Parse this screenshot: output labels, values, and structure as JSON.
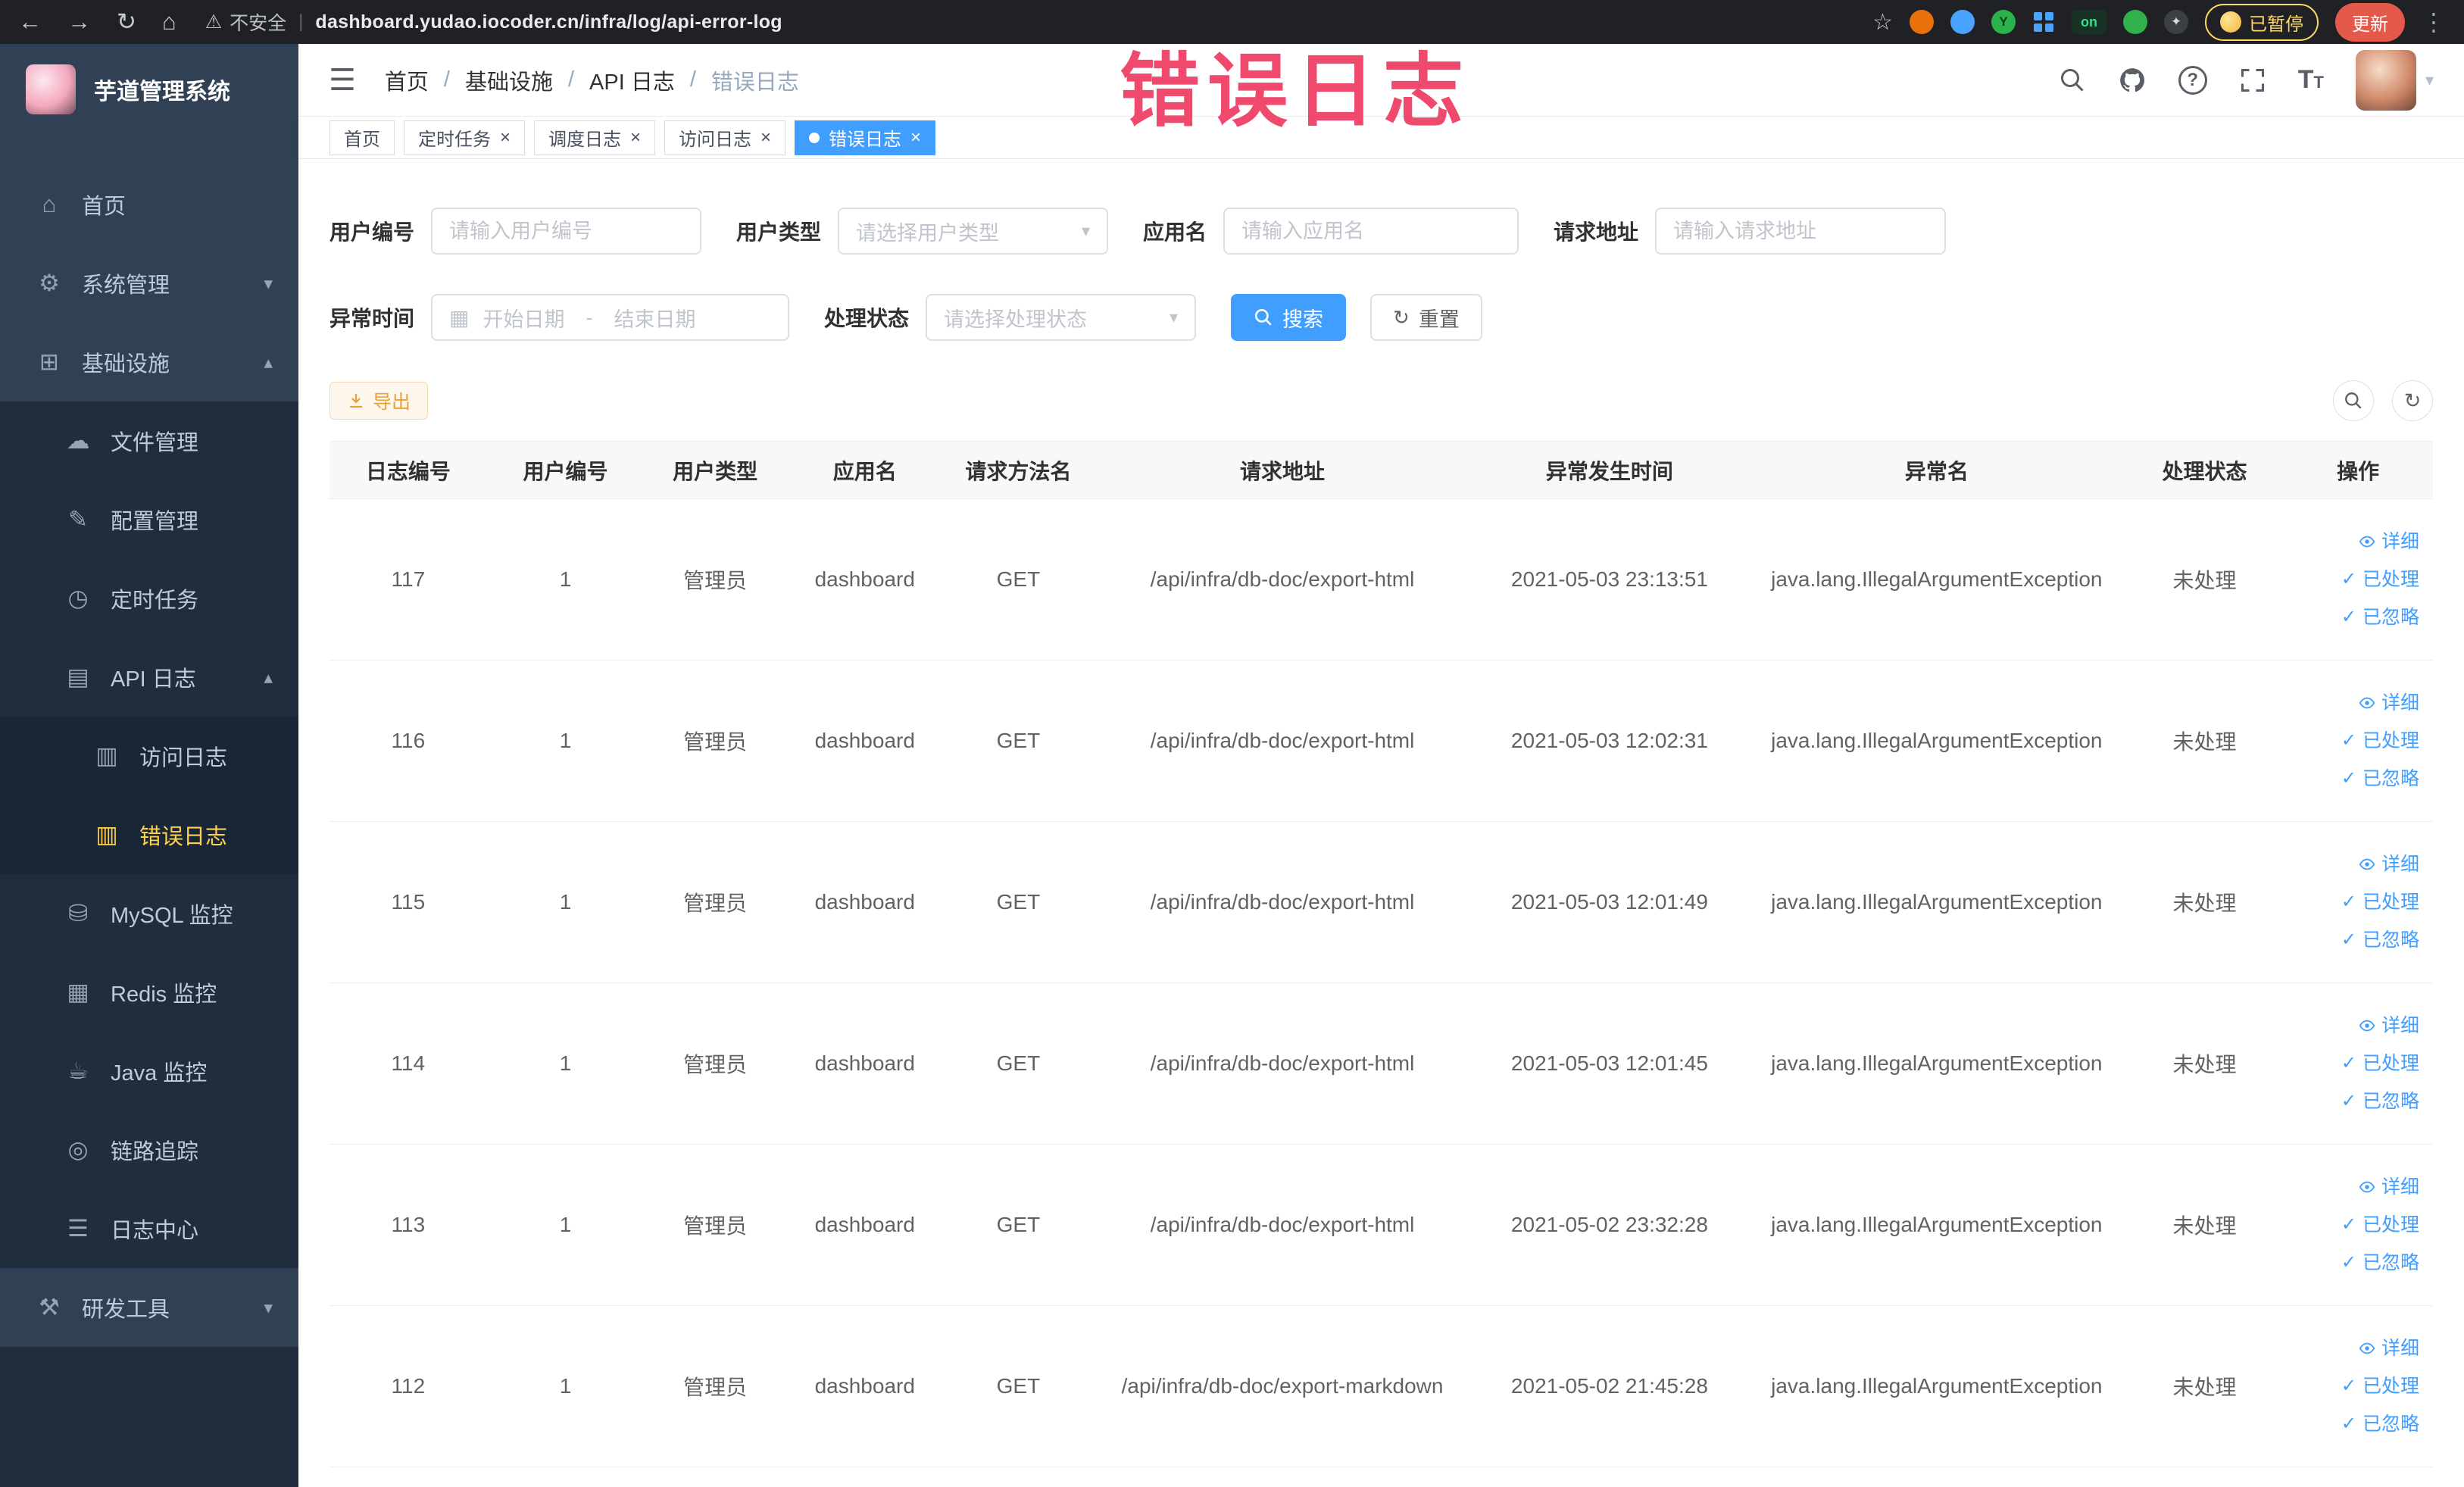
{
  "browser": {
    "security_label": "不安全",
    "url": "dashboard.yudao.iocoder.cn/infra/log/api-error-log",
    "paused_badge": "已暂停",
    "update_button": "更新"
  },
  "watermark": "错误日志",
  "theme": {
    "primary": "#409eff",
    "sidebar_bg": "#304156",
    "menu_active_color": "#ffd04b",
    "watermark_color": "#ef4166",
    "link_color": "#409eff"
  },
  "sidebar": {
    "title": "芋道管理系统",
    "items": [
      {
        "label": "首页",
        "icon": "⌂"
      },
      {
        "label": "系统管理",
        "icon": "⚙",
        "chevron": "▾"
      },
      {
        "label": "基础设施",
        "icon": "⊞",
        "chevron": "▴"
      },
      {
        "label": "文件管理",
        "icon": "☁"
      },
      {
        "label": "配置管理",
        "icon": "✎"
      },
      {
        "label": "定时任务",
        "icon": "◷"
      },
      {
        "label": "API 日志",
        "icon": "▤",
        "chevron": "▴"
      },
      {
        "label": "访问日志",
        "icon": "▥"
      },
      {
        "label": "错误日志",
        "icon": "▥"
      },
      {
        "label": "MySQL 监控",
        "icon": "⛁"
      },
      {
        "label": "Redis 监控",
        "icon": "▦"
      },
      {
        "label": "Java 监控",
        "icon": "☕"
      },
      {
        "label": "链路追踪",
        "icon": "◎"
      },
      {
        "label": "日志中心",
        "icon": "☰"
      },
      {
        "label": "研发工具",
        "icon": "⚒",
        "chevron": "▾"
      }
    ]
  },
  "breadcrumb": [
    "首页",
    "基础设施",
    "API 日志",
    "错误日志"
  ],
  "tabs": [
    {
      "label": "首页",
      "closable": false,
      "active": false
    },
    {
      "label": "定时任务",
      "closable": true,
      "active": false
    },
    {
      "label": "调度日志",
      "closable": true,
      "active": false
    },
    {
      "label": "访问日志",
      "closable": true,
      "active": false
    },
    {
      "label": "错误日志",
      "closable": true,
      "active": true
    }
  ],
  "filters": {
    "user_id": {
      "label": "用户编号",
      "placeholder": "请输入用户编号"
    },
    "user_type": {
      "label": "用户类型",
      "placeholder": "请选择用户类型"
    },
    "app_name": {
      "label": "应用名",
      "placeholder": "请输入应用名"
    },
    "request_url": {
      "label": "请求地址",
      "placeholder": "请输入请求地址"
    },
    "exception_time": {
      "label": "异常时间",
      "start_placeholder": "开始日期",
      "separator": "-",
      "end_placeholder": "结束日期"
    },
    "process_status": {
      "label": "处理状态",
      "placeholder": "请选择处理状态"
    },
    "search_label": "搜索",
    "reset_label": "重置"
  },
  "toolbar": {
    "export_label": "导出"
  },
  "table": {
    "columns": [
      "日志编号",
      "用户编号",
      "用户类型",
      "应用名",
      "请求方法名",
      "请求地址",
      "异常发生时间",
      "异常名",
      "处理状态",
      "操作"
    ],
    "actions": [
      {
        "label": "详细"
      },
      {
        "label": "已处理"
      },
      {
        "label": "已忽略"
      }
    ],
    "rows": [
      {
        "id": "117",
        "user_id": "1",
        "user_type": "管理员",
        "app": "dashboard",
        "method": "GET",
        "url": "/api/infra/db-doc/export-html",
        "time": "2021-05-03 23:13:51",
        "exception": "java.lang.IllegalArgumentException",
        "status": "未处理"
      },
      {
        "id": "116",
        "user_id": "1",
        "user_type": "管理员",
        "app": "dashboard",
        "method": "GET",
        "url": "/api/infra/db-doc/export-html",
        "time": "2021-05-03 12:02:31",
        "exception": "java.lang.IllegalArgumentException",
        "status": "未处理"
      },
      {
        "id": "115",
        "user_id": "1",
        "user_type": "管理员",
        "app": "dashboard",
        "method": "GET",
        "url": "/api/infra/db-doc/export-html",
        "time": "2021-05-03 12:01:49",
        "exception": "java.lang.IllegalArgumentException",
        "status": "未处理"
      },
      {
        "id": "114",
        "user_id": "1",
        "user_type": "管理员",
        "app": "dashboard",
        "method": "GET",
        "url": "/api/infra/db-doc/export-html",
        "time": "2021-05-03 12:01:45",
        "exception": "java.lang.IllegalArgumentException",
        "status": "未处理"
      },
      {
        "id": "113",
        "user_id": "1",
        "user_type": "管理员",
        "app": "dashboard",
        "method": "GET",
        "url": "/api/infra/db-doc/export-html",
        "time": "2021-05-02 23:32:28",
        "exception": "java.lang.IllegalArgumentException",
        "status": "未处理"
      },
      {
        "id": "112",
        "user_id": "1",
        "user_type": "管理员",
        "app": "dashboard",
        "method": "GET",
        "url": "/api/infra/db-doc/export-markdown",
        "time": "2021-05-02 21:45:28",
        "exception": "java.lang.IllegalArgumentException",
        "status": "未处理"
      }
    ]
  }
}
